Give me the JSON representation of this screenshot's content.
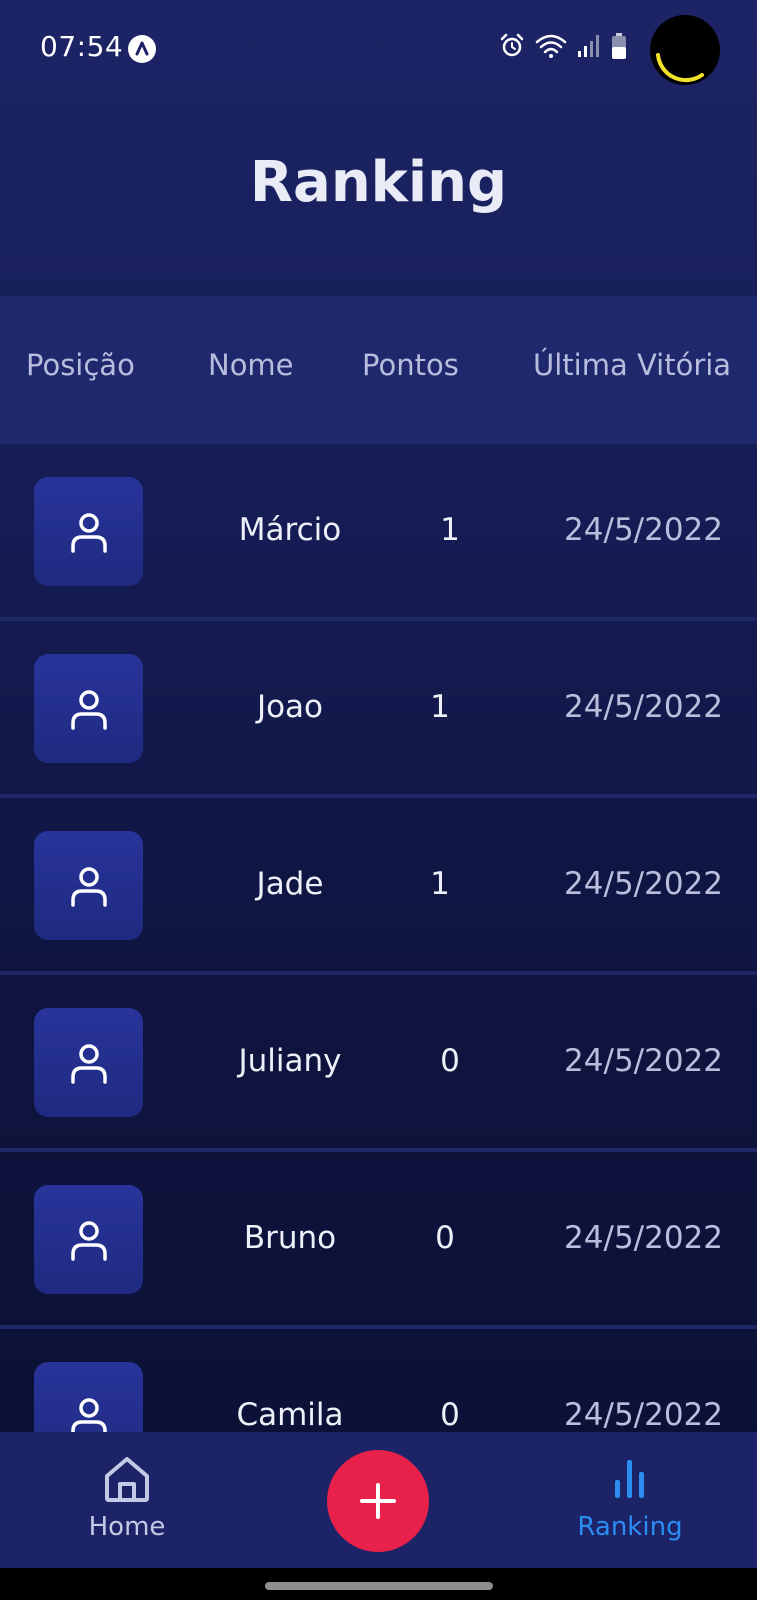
{
  "status_bar": {
    "time": "07:54"
  },
  "header": {
    "title": "Ranking"
  },
  "table": {
    "columns": [
      "Posição",
      "Nome",
      "Pontos",
      "Última Vitória"
    ],
    "rows": [
      {
        "name": "Márcio",
        "points": "1",
        "last_win": "24/5/2022"
      },
      {
        "name": "Joao",
        "points": "1",
        "last_win": "24/5/2022"
      },
      {
        "name": "Jade",
        "points": "1",
        "last_win": "24/5/2022"
      },
      {
        "name": "Juliany",
        "points": "0",
        "last_win": "24/5/2022"
      },
      {
        "name": "Bruno",
        "points": "0",
        "last_win": "24/5/2022"
      },
      {
        "name": "Camila",
        "points": "0",
        "last_win": "24/5/2022"
      }
    ]
  },
  "bottom_nav": {
    "home_label": "Home",
    "ranking_label": "Ranking",
    "active": "ranking"
  },
  "colors": {
    "background": "#161d56",
    "accent_add": "#e8214a",
    "active_tab": "#2b8cf2",
    "avatar_bg": "#28349a"
  },
  "icons": {
    "avatar": "user-icon",
    "home": "home-icon",
    "ranking": "bar-chart-icon",
    "add": "plus-icon"
  }
}
